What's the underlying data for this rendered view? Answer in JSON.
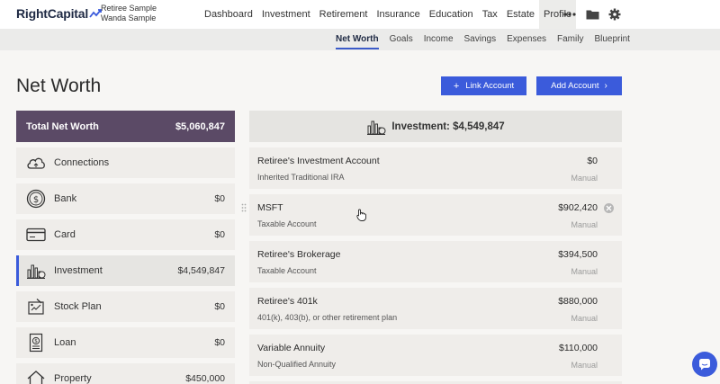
{
  "brand": {
    "logo_text": "RightCapital",
    "accent": "#3b5bdb",
    "total_bg": "#5b4a66"
  },
  "users": {
    "primary": "Retiree Sample",
    "secondary": "Wanda Sample"
  },
  "main_nav": [
    {
      "label": "Dashboard",
      "active": false
    },
    {
      "label": "Investment",
      "active": false
    },
    {
      "label": "Retirement",
      "active": false
    },
    {
      "label": "Insurance",
      "active": false
    },
    {
      "label": "Education",
      "active": false
    },
    {
      "label": "Tax",
      "active": false
    },
    {
      "label": "Estate",
      "active": false
    },
    {
      "label": "Profile",
      "active": true
    }
  ],
  "top_icons": [
    "more-icon",
    "folder-icon",
    "gear-icon"
  ],
  "sub_nav": [
    {
      "label": "Net Worth",
      "active": true
    },
    {
      "label": "Goals",
      "active": false
    },
    {
      "label": "Income",
      "active": false
    },
    {
      "label": "Savings",
      "active": false
    },
    {
      "label": "Expenses",
      "active": false
    },
    {
      "label": "Family",
      "active": false
    },
    {
      "label": "Blueprint",
      "active": false
    }
  ],
  "page": {
    "title": "Net Worth",
    "link_account_label": "Link Account",
    "add_account_label": "Add Account"
  },
  "sidebar": {
    "total_label": "Total Net Worth",
    "total_value": "$5,060,847",
    "items": [
      {
        "label": "Connections",
        "value": "",
        "icon": "cloud-icon"
      },
      {
        "label": "Bank",
        "value": "$0",
        "icon": "dollar-coin-icon"
      },
      {
        "label": "Card",
        "value": "$0",
        "icon": "credit-card-icon"
      },
      {
        "label": "Investment",
        "value": "$4,549,847",
        "icon": "chart-bars-icon"
      },
      {
        "label": "Stock Plan",
        "value": "$0",
        "icon": "stock-certificate-icon"
      },
      {
        "label": "Loan",
        "value": "$0",
        "icon": "loan-icon"
      },
      {
        "label": "Property",
        "value": "$450,000",
        "icon": "house-icon"
      }
    ]
  },
  "investment": {
    "header": "Investment: $4,549,847",
    "accounts": [
      {
        "name": "Retiree's Investment Account",
        "type": "Inherited Traditional IRA",
        "value": "$0",
        "source": "Manual"
      },
      {
        "name": "MSFT",
        "type": "Taxable Account",
        "value": "$902,420",
        "source": "Manual"
      },
      {
        "name": "Retiree's Brokerage",
        "type": "Taxable Account",
        "value": "$394,500",
        "source": "Manual"
      },
      {
        "name": "Retiree's 401k",
        "type": "401(k), 403(b), or other retirement plan",
        "value": "$880,000",
        "source": "Manual"
      },
      {
        "name": "Variable Annuity",
        "type": "Non-Qualified Annuity",
        "value": "$110,000",
        "source": "Manual"
      }
    ]
  }
}
